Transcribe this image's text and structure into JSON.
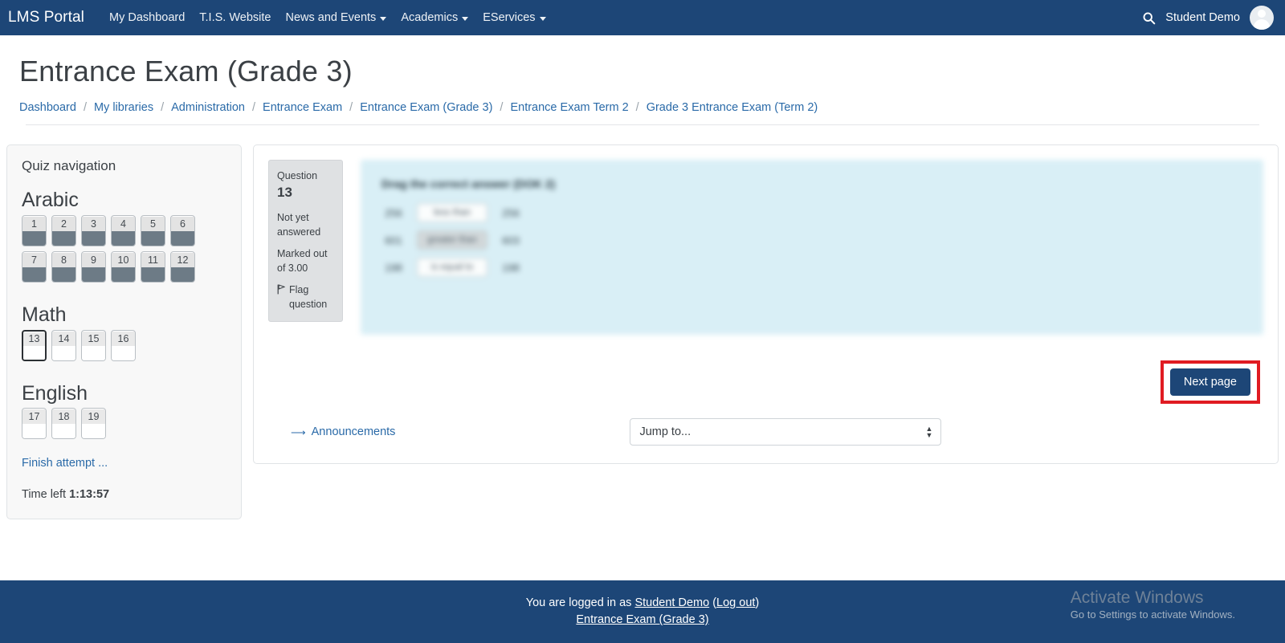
{
  "navbar": {
    "brand": "LMS Portal",
    "links": [
      {
        "label": "My Dashboard",
        "has_caret": false
      },
      {
        "label": "T.I.S. Website",
        "has_caret": false
      },
      {
        "label": "News and Events",
        "has_caret": true
      },
      {
        "label": "Academics",
        "has_caret": true
      },
      {
        "label": "EServices",
        "has_caret": true
      }
    ],
    "search_icon": "search-icon",
    "user_name": "Student Demo",
    "avatar_icon": "user-avatar-icon"
  },
  "header": {
    "title": "Entrance Exam (Grade 3)",
    "breadcrumb": [
      "Dashboard",
      "My libraries",
      "Administration",
      "Entrance Exam",
      "Entrance Exam (Grade 3)",
      "Entrance Exam Term 2",
      "Grade 3 Entrance Exam (Term 2)"
    ],
    "breadcrumb_separator": "/"
  },
  "quiz_navigation": {
    "title": "Quiz navigation",
    "sections": [
      {
        "heading": "Arabic",
        "questions": [
          {
            "number": "1",
            "state": "answered"
          },
          {
            "number": "2",
            "state": "answered"
          },
          {
            "number": "3",
            "state": "answered"
          },
          {
            "number": "4",
            "state": "answered"
          },
          {
            "number": "5",
            "state": "answered"
          },
          {
            "number": "6",
            "state": "answered"
          },
          {
            "number": "7",
            "state": "answered"
          },
          {
            "number": "8",
            "state": "answered"
          },
          {
            "number": "9",
            "state": "answered"
          },
          {
            "number": "10",
            "state": "answered"
          },
          {
            "number": "11",
            "state": "answered"
          },
          {
            "number": "12",
            "state": "answered"
          }
        ]
      },
      {
        "heading": "Math",
        "questions": [
          {
            "number": "13",
            "state": "current"
          },
          {
            "number": "14",
            "state": "not-answered"
          },
          {
            "number": "15",
            "state": "not-answered"
          },
          {
            "number": "16",
            "state": "not-answered"
          }
        ]
      },
      {
        "heading": "English",
        "questions": [
          {
            "number": "17",
            "state": "not-answered"
          },
          {
            "number": "18",
            "state": "not-answered"
          },
          {
            "number": "19",
            "state": "not-answered"
          }
        ]
      }
    ],
    "finish_attempt": "Finish attempt ...",
    "time_left_label": "Time left",
    "time_left_value": "1:13:57"
  },
  "question": {
    "info": {
      "question_label": "Question",
      "question_number": "13",
      "status": "Not yet answered",
      "marked_out_of": "Marked out of 3.00",
      "flag_label": "Flag question",
      "flag_icon": "flag-icon"
    },
    "content": {
      "prompt": "Drag the correct answer (DOK 2)",
      "rows": [
        {
          "left": "256",
          "drop": "less than",
          "right": "256",
          "filled": false
        },
        {
          "left": "601",
          "drop": "greater than",
          "right": "603",
          "filled": true
        },
        {
          "left": "198",
          "drop": "is equal to",
          "right": "198",
          "filled": false
        }
      ]
    }
  },
  "actions": {
    "next_page": "Next page",
    "highlight_color": "#e01b22"
  },
  "bottom_nav": {
    "announcements": "Announcements",
    "arrow_icon": "arrow-left-icon",
    "jump_to_selected": "Jump to..."
  },
  "footer": {
    "logged_in_prefix": "You are logged in as",
    "user_name": "Student Demo",
    "logout_open": "(",
    "logout": "Log out",
    "logout_close": ")",
    "course": "Entrance Exam (Grade 3)"
  },
  "watermark": {
    "title": "Activate Windows",
    "subtitle": "Go to Settings to activate Windows."
  }
}
